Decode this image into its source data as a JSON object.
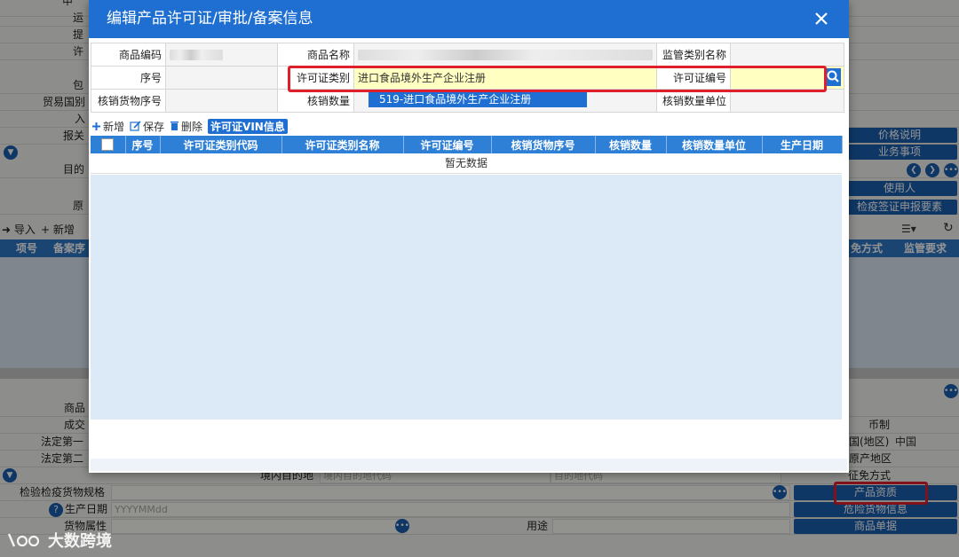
{
  "background": {
    "labels": {
      "top1": "申",
      "top2": "运",
      "top3": "提",
      "top4": "许",
      "top5": "包",
      "trade_country": "贸易国别",
      "entry": "入",
      "declare": "报关",
      "dest": "目的",
      "origin": "原",
      "product": "商品",
      "deal": "成交",
      "legal1": "法定第一",
      "legal2": "法定第二",
      "domestic_dest": "境内目的地",
      "inspection_spec": "检验检疫货物规格",
      "prod_date": "生产日期",
      "cargo_attr": "货物属性",
      "usage": "用途",
      "currency": "币制",
      "country_region": "国(地区)",
      "country_value": "中国",
      "origin_region": "原产地区",
      "tax_method": "征免方式"
    },
    "placeholders": {
      "prod_date": "YYYYMMdd",
      "domestic_dest_code": "境内目的地代码",
      "dest_code": "目的地代码"
    },
    "buttons": {
      "price_desc": "价格说明",
      "business": "业务事项",
      "user": "使用人",
      "quarantine": "检疫签证申报要素",
      "product_qual": "产品资质",
      "dangerous": "危险货物信息",
      "product_list": "商品单据"
    },
    "toolbar": {
      "import": "导入",
      "add": "新增"
    },
    "table_head": {
      "item_no": "项号",
      "record_no": "备案序",
      "tax": "免方式",
      "supervision": "监管要求"
    }
  },
  "dialog": {
    "title": "编辑产品许可证/审批/备案信息",
    "form": {
      "product_code_label": "商品编码",
      "product_name_label": "商品名称",
      "supervision_type_label": "监管类别名称",
      "seq_label": "序号",
      "license_type_label": "许可证类别",
      "license_type_value": "进口食品境外生产企业注册",
      "license_no_label": "许可证编号",
      "license_no_value": "",
      "writeoff_seq_label": "核销货物序号",
      "writeoff_qty_label": "核销数量",
      "writeoff_unit_label": "核销数量单位"
    },
    "dropdown_option": "519-进口食品境外生产企业注册",
    "toolbar": {
      "add": "新增",
      "save": "保存",
      "delete": "删除",
      "vin": "许可证VIN信息"
    },
    "grid": {
      "columns": [
        "序号",
        "许可证类别代码",
        "许可证类别名称",
        "许可证编号",
        "核销货物序号",
        "核销数量",
        "核销数量单位",
        "生产日期"
      ],
      "empty_text": "暂无数据"
    }
  },
  "watermark": "大数跨境",
  "colors": {
    "accent": "#1e6fd1",
    "highlight_box": "#e01f2d",
    "highlight_field": "#ffffc2"
  }
}
